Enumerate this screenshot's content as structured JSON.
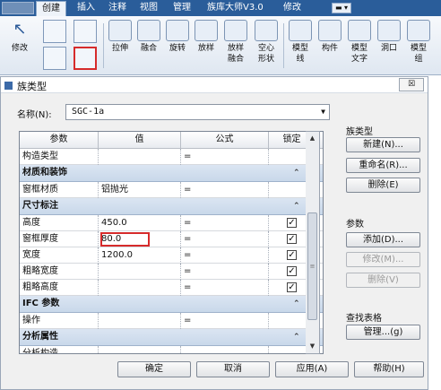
{
  "ribbon": {
    "tabs": [
      "创建",
      "插入",
      "注释",
      "视图",
      "管理",
      "族库大师V3.0",
      "修改"
    ],
    "modify_label": "修改",
    "buttons": [
      "拉伸",
      "融合",
      "旋转",
      "放样",
      "放样\n融合",
      "空心\n形状",
      "模型\n线",
      "构件",
      "模型\n文字",
      "洞口",
      "模型\n组"
    ]
  },
  "dialog": {
    "title": "族类型",
    "close_label": "☒",
    "name_label": "名称(N):",
    "name_value": "SGC-1a",
    "columns": [
      "参数",
      "值",
      "公式",
      "锁定"
    ],
    "rows": [
      {
        "type": "row",
        "param": "构造类型",
        "value": "",
        "formula": "=",
        "lock": false,
        "show_lock": false
      },
      {
        "type": "group",
        "label": "材质和装饰"
      },
      {
        "type": "row",
        "param": "窗框材质",
        "value": "铝抛光",
        "formula": "=",
        "lock": false,
        "show_lock": false
      },
      {
        "type": "group",
        "label": "尺寸标注"
      },
      {
        "type": "row",
        "param": "高度",
        "value": "450.0",
        "formula": "=",
        "lock": true,
        "show_lock": true
      },
      {
        "type": "row",
        "param": "窗框厚度",
        "value": "80.0",
        "formula": "=",
        "lock": true,
        "show_lock": true
      },
      {
        "type": "row",
        "param": "宽度",
        "value": "1200.0",
        "formula": "=",
        "lock": true,
        "show_lock": true
      },
      {
        "type": "row",
        "param": "粗略宽度",
        "value": "",
        "formula": "=",
        "lock": true,
        "show_lock": true
      },
      {
        "type": "row",
        "param": "粗略高度",
        "value": "",
        "formula": "=",
        "lock": true,
        "show_lock": true
      },
      {
        "type": "group",
        "label": "IFC 参数"
      },
      {
        "type": "row",
        "param": "操作",
        "value": "",
        "formula": "=",
        "lock": false,
        "show_lock": false
      },
      {
        "type": "group",
        "label": "分析属性"
      },
      {
        "type": "row",
        "param": "分析构造",
        "value": "",
        "formula": "",
        "lock": false,
        "show_lock": false
      }
    ],
    "side": {
      "family_types_label": "族类型",
      "new_btn": "新建(N)...",
      "rename_btn": "重命名(R)...",
      "delete_btn": "删除(E)",
      "params_label": "参数",
      "add_btn": "添加(D)...",
      "modify_btn": "修改(M)...",
      "remove_btn": "删除(V)",
      "lookup_label": "查找表格",
      "manage_btn": "管理...(g)"
    },
    "footer": {
      "ok": "确定",
      "cancel": "取消",
      "apply": "应用(A)",
      "help": "帮助(H)"
    }
  }
}
